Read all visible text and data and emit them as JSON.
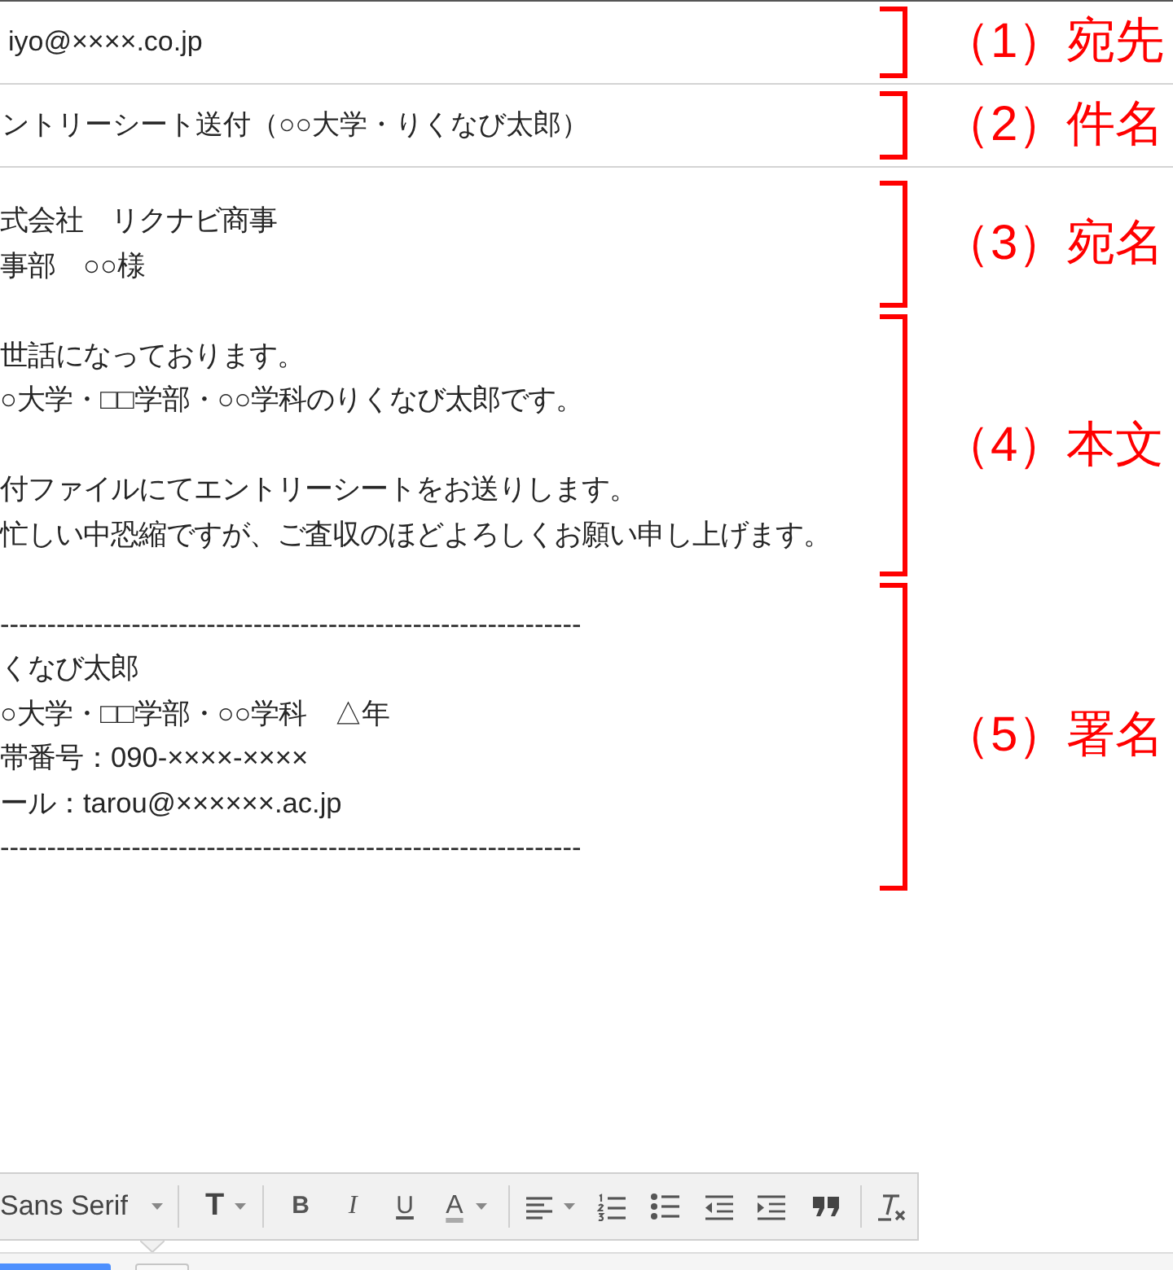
{
  "compose": {
    "to": {
      "value": "iyo@××××.co.jp",
      "annotation": "（1）宛先"
    },
    "subject": {
      "value": "ントリーシート送付（○○大学・りくなび太郎）",
      "annotation": "（2）件名"
    },
    "body": [
      {
        "annotation": "（3）宛名",
        "paragraphs": [
          [
            "式会社　リクナビ商事",
            "事部　○○様"
          ]
        ]
      },
      {
        "annotation": "（4）本文",
        "paragraphs": [
          [
            "世話になっております。",
            "○大学・□□学部・○○学科のりくなび太郎です。"
          ],
          [
            "付ファイルにてエントリーシートをお送りします。",
            "忙しい中恐縮ですが、ご査収のほどよろしくお願い申し上げます。"
          ]
        ]
      },
      {
        "annotation": "（5）署名",
        "paragraphs": [
          [
            "--------------------------------------------------------------",
            "くなび太郎",
            "○大学・□□学部・○○学科　△年",
            "帯番号：090-××××-××××",
            "ール：tarou@××××××.ac.jp",
            "--------------------------------------------------------------"
          ]
        ]
      }
    ]
  },
  "format_toolbar": {
    "groups": [
      [
        {
          "kind": "font",
          "label": "Sans Serif",
          "dropdown": true
        }
      ],
      [
        {
          "kind": "size",
          "label": "T",
          "dropdown": true
        }
      ],
      [
        {
          "kind": "bold",
          "label": "B",
          "dropdown": false
        },
        {
          "kind": "italic",
          "label": "I",
          "dropdown": false
        },
        {
          "kind": "underline",
          "label": "U",
          "dropdown": false
        },
        {
          "kind": "color",
          "label": "A",
          "dropdown": true
        }
      ],
      [
        {
          "kind": "align",
          "dropdown": true
        },
        {
          "kind": "numbered-list",
          "dropdown": false
        },
        {
          "kind": "bulleted-list",
          "dropdown": false
        },
        {
          "kind": "outdent",
          "dropdown": false
        },
        {
          "kind": "indent",
          "dropdown": false
        },
        {
          "kind": "quote",
          "dropdown": false
        }
      ],
      [
        {
          "kind": "clear-format",
          "dropdown": false
        }
      ]
    ]
  }
}
